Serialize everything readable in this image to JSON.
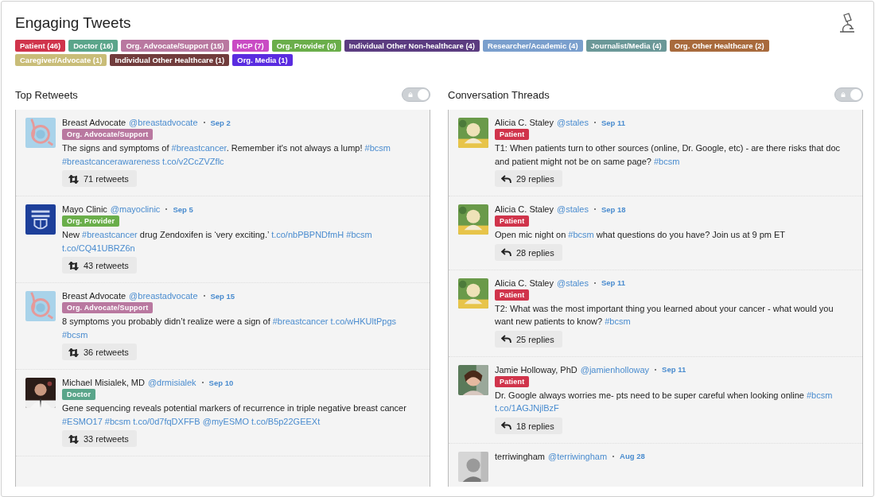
{
  "title": "Engaging Tweets",
  "legend": [
    {
      "label": "Patient (46)",
      "color": "#d0344b"
    },
    {
      "label": "Doctor (16)",
      "color": "#5aa58a"
    },
    {
      "label": "Org. Advocate/Support (15)",
      "color": "#b978a0"
    },
    {
      "label": "HCP (7)",
      "color": "#c94bc4"
    },
    {
      "label": "Org. Provider (6)",
      "color": "#6aae4a"
    },
    {
      "label": "Individual Other Non-healthcare (4)",
      "color": "#5b3c80"
    },
    {
      "label": "Researcher/Academic (4)",
      "color": "#7a9fcd"
    },
    {
      "label": "Journalist/Media (4)",
      "color": "#6b9898"
    },
    {
      "label": "Org. Other Healthcare (2)",
      "color": "#a86a3c"
    },
    {
      "label": "Caregiver/Advocate (1)",
      "color": "#c9bd78"
    },
    {
      "label": "Individual Other Healthcare (1)",
      "color": "#713c3c"
    },
    {
      "label": "Org. Media (1)",
      "color": "#5a2ce0"
    }
  ],
  "columns": [
    {
      "title": "Top Retweets",
      "kind": "retweets",
      "toggle": {
        "on": true
      },
      "tweets": [
        {
          "author": "Breast Advocate",
          "handle": "@breastadvocate",
          "date": "Sep 2",
          "avatar": {
            "kind": "picture"
          },
          "tag": {
            "label": "Org. Advocate/Support",
            "color": "#b978a0"
          },
          "text": [
            {
              "kind": "text",
              "text": "The signs and symptoms of "
            },
            {
              "kind": "link",
              "text": "#breastcancer"
            },
            {
              "kind": "text",
              "text": ". Remember it's not always a lump! "
            },
            {
              "kind": "link",
              "text": "#bcsm"
            },
            {
              "kind": "link",
              "text": "#breastcancerawareness"
            },
            {
              "kind": "link",
              "text": "t.co/v2CcZVZflc"
            }
          ],
          "count": "71 retweets"
        },
        {
          "author": "Mayo Clinic",
          "handle": "@mayoclinic",
          "date": "Sep 5",
          "avatar": {
            "kind": "picture"
          },
          "tag": {
            "label": "Org. Provider",
            "color": "#6aae4a"
          },
          "text": [
            {
              "kind": "text",
              "text": "New "
            },
            {
              "kind": "link",
              "text": "#breastcancer"
            },
            {
              "kind": "text",
              "text": " drug Zendoxifen is ‘very exciting.’ "
            },
            {
              "kind": "link",
              "text": "t.co/nbPBPNDfmH"
            },
            {
              "kind": "link",
              "text": "#bcsm"
            },
            {
              "kind": "link",
              "text": "t.co/CQ41UBRZ6n"
            }
          ],
          "count": "43 retweets"
        },
        {
          "author": "Breast Advocate",
          "handle": "@breastadvocate",
          "date": "Sep 15",
          "avatar": {
            "kind": "picture"
          },
          "tag": {
            "label": "Org. Advocate/Support",
            "color": "#b978a0"
          },
          "text": [
            {
              "kind": "text",
              "text": "8 symptoms you probably didn’t realize were a sign of "
            },
            {
              "kind": "link",
              "text": "#breastcancer"
            },
            {
              "kind": "link",
              "text": "t.co/wHKUltPpgs"
            },
            {
              "kind": "link",
              "text": "#bcsm"
            }
          ],
          "count": "36 retweets"
        },
        {
          "author": "Michael Misialek, MD",
          "handle": "@drmisialek",
          "date": "Sep 10",
          "avatar": {
            "kind": "picture"
          },
          "tag": {
            "label": "Doctor",
            "color": "#5aa58a"
          },
          "text": [
            {
              "kind": "text",
              "text": "Gene sequencing reveals potential markers of recurrence in triple negative breast cancer "
            },
            {
              "kind": "link",
              "text": "#ESMO17"
            },
            {
              "kind": "link",
              "text": "#bcsm"
            },
            {
              "kind": "link",
              "text": "t.co/0d7fqDXFFB"
            },
            {
              "kind": "link",
              "text": "@myESMO"
            },
            {
              "kind": "link",
              "text": "t.co/B5p22GEEXt"
            }
          ],
          "count": "33 retweets"
        }
      ]
    },
    {
      "title": "Conversation Threads",
      "kind": "replies",
      "toggle": {
        "on": true
      },
      "tweets": [
        {
          "author": "Alicia C. Staley",
          "handle": "@stales",
          "date": "Sep 11",
          "avatar": {
            "kind": "picture"
          },
          "tag": {
            "label": "Patient",
            "color": "#d0344b"
          },
          "text": [
            {
              "kind": "text",
              "text": "T1: When patients turn to other sources (online, Dr. Google, etc) - are there risks that doc and patient might not be on same page? "
            },
            {
              "kind": "link",
              "text": "#bcsm"
            }
          ],
          "count": "29 replies"
        },
        {
          "author": "Alicia C. Staley",
          "handle": "@stales",
          "date": "Sep 18",
          "avatar": {
            "kind": "picture"
          },
          "tag": {
            "label": "Patient",
            "color": "#d0344b"
          },
          "text": [
            {
              "kind": "text",
              "text": "Open mic night on "
            },
            {
              "kind": "link",
              "text": "#bcsm"
            },
            {
              "kind": "text",
              "text": " what questions do you have? Join us at 9 pm ET"
            }
          ],
          "count": "28 replies"
        },
        {
          "author": "Alicia C. Staley",
          "handle": "@stales",
          "date": "Sep 11",
          "avatar": {
            "kind": "picture"
          },
          "tag": {
            "label": "Patient",
            "color": "#d0344b"
          },
          "text": [
            {
              "kind": "text",
              "text": "T2: What was the most important thing you learned about your cancer - what would you want new patients to know? "
            },
            {
              "kind": "link",
              "text": "#bcsm"
            }
          ],
          "count": "25 replies"
        },
        {
          "author": "Jamie Holloway, PhD",
          "handle": "@jamienholloway",
          "date": "Sep 11",
          "avatar": {
            "kind": "picture"
          },
          "tag": {
            "label": "Patient",
            "color": "#d0344b"
          },
          "text": [
            {
              "kind": "text",
              "text": "Dr. Google always worries me- pts need to be super careful when looking online "
            },
            {
              "kind": "link",
              "text": "#bcsm"
            },
            {
              "kind": "link",
              "text": "t.co/1AGJNjlBzF"
            }
          ],
          "count": "18 replies"
        },
        {
          "author": "terriwingham",
          "handle": "@terriwingham",
          "date": "Aug 28",
          "avatar": {
            "kind": "picture"
          }
        }
      ]
    }
  ]
}
